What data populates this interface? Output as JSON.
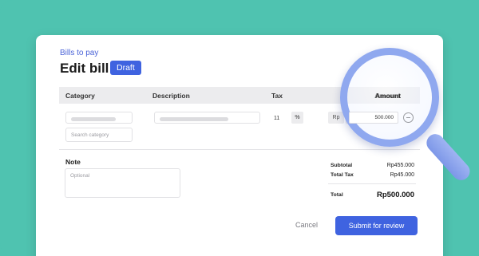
{
  "header": {
    "breadcrumb": "Bills to pay",
    "title": "Edit bill",
    "status": "Draft"
  },
  "table": {
    "columns": [
      "Category",
      "Description",
      "Tax",
      "Amount"
    ],
    "row": {
      "category_search_placeholder": "Search category",
      "tax_value": "11",
      "tax_unit": "%",
      "currency": "Rp",
      "amount": "500.000"
    }
  },
  "note": {
    "label": "Note",
    "placeholder": "Optional"
  },
  "summary": {
    "subtotal_label": "Subtotal",
    "subtotal_value": "Rp455.000",
    "tax_label": "Total Tax",
    "tax_value": "Rp45.000",
    "total_label": "Total",
    "total_value": "Rp500.000"
  },
  "actions": {
    "cancel": "Cancel",
    "submit": "Submit for review"
  },
  "colors": {
    "background": "#4fc3b0",
    "accent": "#3f63e0",
    "magnifier": "#8fa8ef"
  },
  "icons": {
    "remove": "minus-circle-icon",
    "magnifier": "magnifying-glass-icon"
  }
}
